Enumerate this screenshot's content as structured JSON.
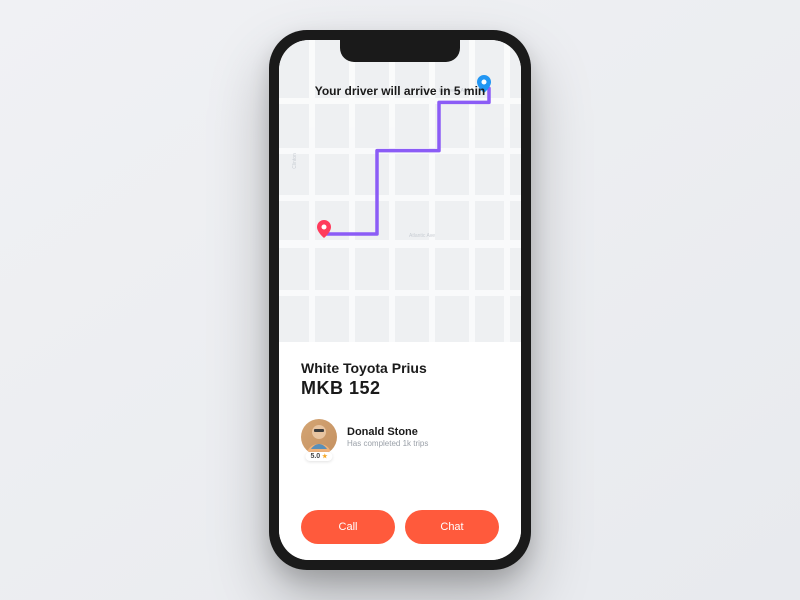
{
  "arrival": {
    "banner": "Your driver will arrive in 5 min"
  },
  "car": {
    "description": "White Toyota Prius",
    "plate": "MKB 152"
  },
  "driver": {
    "name": "Donald Stone",
    "subtitle": "Has completed 1k trips",
    "rating": "5.0"
  },
  "actions": {
    "call": "Call",
    "chat": "Chat"
  },
  "colors": {
    "accent": "#ff5a3c",
    "route": "#8b5cf6",
    "pin_dest": "#2196f3",
    "pin_origin": "#ff3b5c"
  }
}
